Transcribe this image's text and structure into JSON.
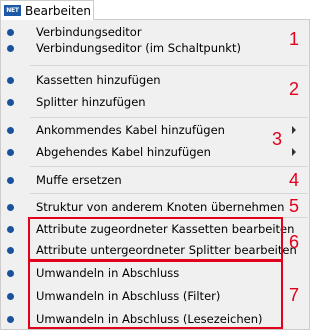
{
  "menubar": {
    "app_icon_text": "NET",
    "tab_label": "Bearbeiten",
    "app_icon_color": "#1c5aa8"
  },
  "menu": {
    "items": [
      {
        "label": "Verbindungseditor",
        "bullet_icon": "dot-icon"
      },
      {
        "label": "Verbindungseditor (im Schaltpunkt)",
        "bullet_icon": "dot-icon"
      },
      {
        "label": "Kassetten hinzufügen",
        "bullet_icon": "dot-icon"
      },
      {
        "label": "Splitter hinzufügen",
        "bullet_icon": "dot-icon"
      },
      {
        "label": "Ankommendes Kabel hinzufügen",
        "bullet_icon": "dot-icon",
        "submenu": true
      },
      {
        "label": "Abgehendes Kabel hinzufügen",
        "bullet_icon": "dot-icon",
        "submenu": true
      },
      {
        "label": "Muffe ersetzen",
        "bullet_icon": "dot-icon"
      },
      {
        "label": "Struktur von anderem Knoten übernehmen",
        "bullet_icon": "dot-icon"
      },
      {
        "label": "Attribute zugeordneter Kassetten bearbeiten",
        "bullet_icon": "dot-icon"
      },
      {
        "label": "Attribute untergeordneter Splitter bearbeiten",
        "bullet_icon": "dot-icon"
      },
      {
        "label": "Umwandeln in Abschluss",
        "bullet_icon": "dot-icon"
      },
      {
        "label": "Umwandeln in Abschluss (Filter)",
        "bullet_icon": "dot-icon"
      },
      {
        "label": "Umwandeln in Abschluss (Lesezeichen)",
        "bullet_icon": "dot-icon"
      }
    ]
  },
  "annotations": {
    "group_numbers": [
      "1",
      "2",
      "3",
      "4",
      "5",
      "6",
      "7"
    ],
    "color": "#e3001b"
  },
  "colors": {
    "bullet": "#1a52a0",
    "menu_background": "#f0f0f0",
    "annotation": "#e3001b"
  }
}
